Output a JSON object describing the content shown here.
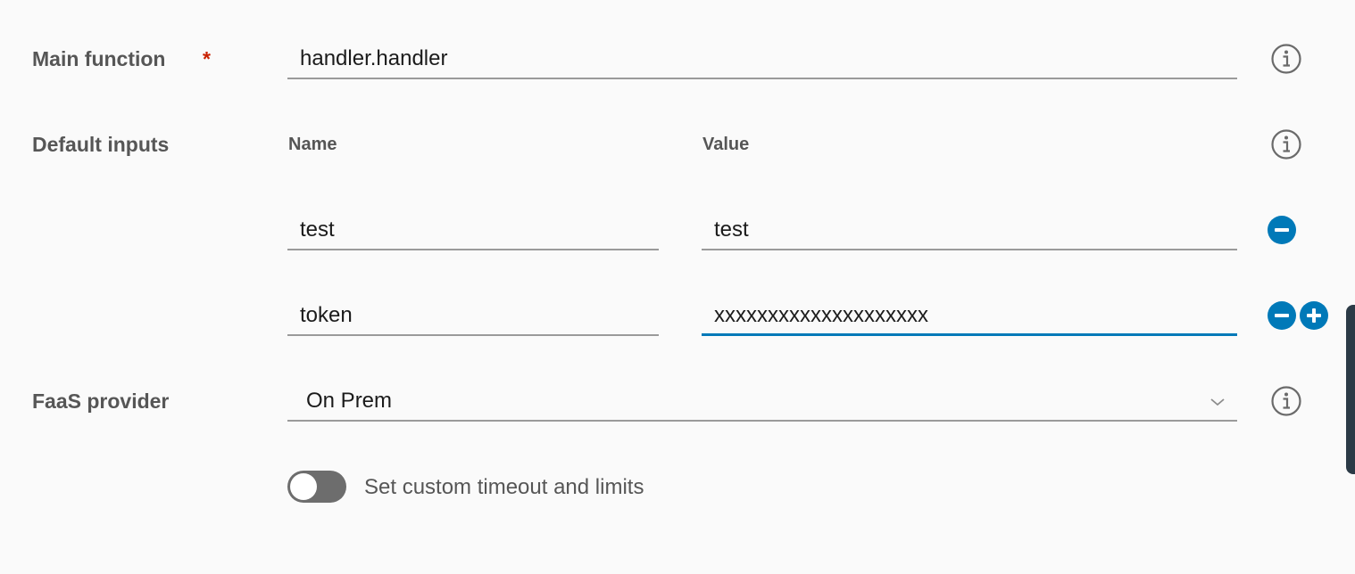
{
  "main_function": {
    "label": "Main function",
    "required_mark": "*",
    "value": "handler.handler",
    "info_icon": "info-icon"
  },
  "default_inputs": {
    "label": "Default inputs",
    "name_header": "Name",
    "value_header": "Value",
    "info_icon": "info-icon",
    "rows": [
      {
        "name": "test",
        "value": "test"
      },
      {
        "name": "token",
        "value": "xxxxxxxxxxxxxxxxxxxx"
      }
    ],
    "remove_icon": "minus-circle-icon",
    "add_icon": "plus-circle-icon"
  },
  "faas_provider": {
    "label": "FaaS provider",
    "selected": "On Prem",
    "chevron_icon": "chevron-down-icon",
    "info_icon": "info-icon"
  },
  "custom_limits": {
    "label": "Set custom timeout and limits",
    "enabled": false
  },
  "colors": {
    "accent": "#0079b8",
    "required": "#c92100",
    "toggle_off": "#6d6d6d",
    "background": "#fafafa"
  }
}
